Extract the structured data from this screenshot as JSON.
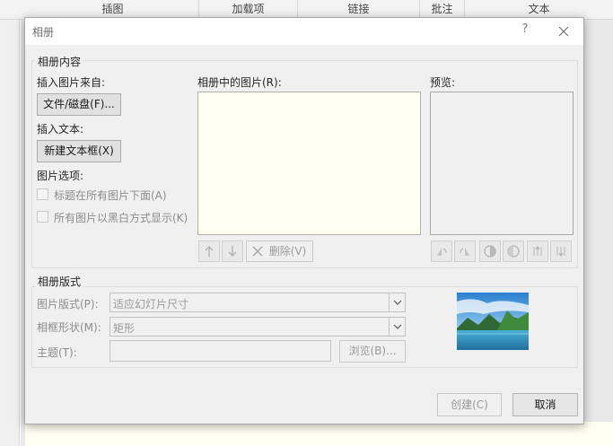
{
  "ribbon": {
    "groups": [
      "插图",
      "加载项",
      "链接",
      "批注",
      "文本"
    ]
  },
  "dialog": {
    "title": "相册",
    "help_label": "?",
    "album_content": {
      "legend": "相册内容",
      "insert_from_label": "插入图片来自:",
      "file_disk_button": "文件/磁盘(F)...",
      "insert_text_label": "插入文本:",
      "new_textbox_button": "新建文本框(X)",
      "picture_options_label": "图片选项:",
      "option_captions": "标题在所有图片下面(A)",
      "option_bw": "所有图片以黑白方式显示(K)",
      "pictures_in_album_label": "相册中的图片(R):",
      "preview_label": "预览:",
      "remove_button": "删除(V)"
    },
    "album_layout": {
      "legend": "相册版式",
      "picture_layout_label": "图片版式(P):",
      "picture_layout_value": "适应幻灯片尺寸",
      "frame_shape_label": "相框形状(M):",
      "frame_shape_value": "矩形",
      "theme_label": "主题(T):",
      "theme_value": "",
      "browse_button": "浏览(B)..."
    },
    "create_button": "创建(C)",
    "cancel_button": "取消"
  },
  "colors": {
    "dialog_bg": "#f0f0f0",
    "list_bg": "#fffff2",
    "disabled_text": "#8c8c8c"
  }
}
